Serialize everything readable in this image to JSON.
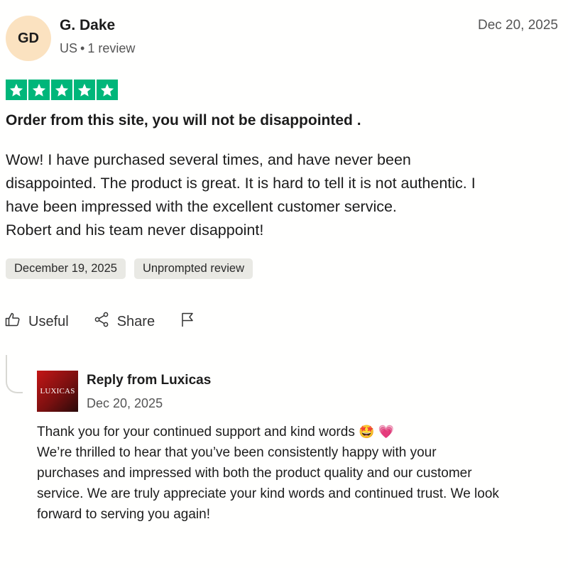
{
  "reviewer": {
    "initials": "GD",
    "name": "G. Dake",
    "country": "US",
    "separator": "•",
    "review_count": "1 review",
    "avatar_color": "#fbe2c0"
  },
  "review": {
    "date": "Dec 20, 2025",
    "rating": 5,
    "star_color": "#00b67a",
    "title": "Order from this site, you will not be disappointed .",
    "body_lines": [
      "Wow! I have purchased several times, and have never been",
      "disappointed. The product is great. It is hard to tell it is not authentic. I",
      "have been impressed with the excellent customer service.",
      "Robert and his team never disappoint!"
    ],
    "tags": [
      "December 19, 2025",
      "Unprompted review"
    ]
  },
  "actions": {
    "useful_label": "Useful",
    "share_label": "Share",
    "useful_icon": "thumbs-up-icon",
    "share_icon": "share-icon",
    "flag_icon": "flag-icon"
  },
  "reply": {
    "logo_text": "LUXICAS",
    "from": "Reply from Luxicas",
    "date": "Dec 20, 2025",
    "body_lines": [
      "Thank you for your continued support and kind words",
      "We’re thrilled to hear that you’ve been consistently happy with your",
      "purchases and impressed with both the product quality and our customer",
      "service. We are truly appreciate your kind words and continued trust. We look",
      "forward to serving you again!"
    ],
    "emoji": [
      "🤩",
      "💗"
    ]
  }
}
